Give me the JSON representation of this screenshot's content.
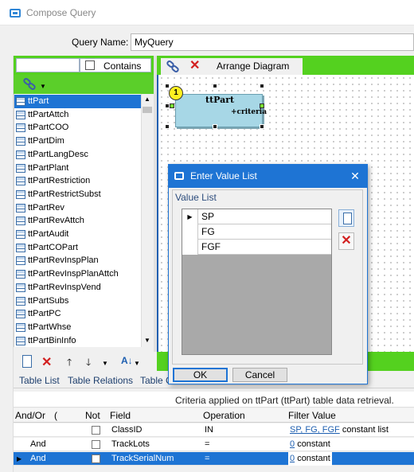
{
  "window": {
    "title": "Compose Query"
  },
  "query_name": {
    "label": "Query Name:",
    "value": "MyQuery"
  },
  "left_panel": {
    "search_value": "",
    "contains_label": "Contains",
    "tables": [
      "ttPart",
      "ttPartAttch",
      "ttPartCOO",
      "ttPartDim",
      "ttPartLangDesc",
      "ttPartPlant",
      "ttPartRestriction",
      "ttPartRestrictSubst",
      "ttPartRev",
      "ttPartRevAttch",
      "ttPartAudit",
      "ttPartCOPart",
      "ttPartRevInspPlan",
      "ttPartRevInspPlanAttch",
      "ttPartRevInspVend",
      "ttPartSubs",
      "ttPartPC",
      "ttPartWhse",
      "ttPartBinInfo"
    ],
    "selected_index": 0
  },
  "diagram": {
    "arrange_label": "Arrange Diagram",
    "entity": {
      "badge": "1",
      "title": "ttPart",
      "criteria": "+criteria"
    }
  },
  "dialog": {
    "title": "Enter Value List",
    "group_label": "Value List",
    "values": [
      "SP",
      "FG",
      "FGF"
    ],
    "ok_label": "OK",
    "cancel_label": "Cancel"
  },
  "tabs": [
    "Table List",
    "Table Relations",
    "Table C"
  ],
  "criteria": {
    "header_text": "Criteria applied on ttPart (ttPart)  table data retrieval.",
    "columns": [
      "And/Or",
      "(",
      "Not",
      "Field",
      "Operation",
      "Filter Value"
    ],
    "rows": [
      {
        "andor": "",
        "field": "ClassID",
        "operation": "IN",
        "filter_link": "SP, FG, FGF",
        "filter_suffix": "constant list"
      },
      {
        "andor": "And",
        "field": "TrackLots",
        "operation": "=",
        "filter_link": "0",
        "filter_suffix": "constant"
      },
      {
        "andor": "And",
        "field": "TrackSerialNum",
        "operation": "=",
        "filter_link": "0",
        "filter_suffix": "constant"
      }
    ],
    "selected_row": 2
  },
  "colors": {
    "accent": "#1e74d4",
    "toolbar_green": "#54d11f",
    "delete_red": "#d21f1f",
    "entity_fill": "#a7d7e6"
  }
}
